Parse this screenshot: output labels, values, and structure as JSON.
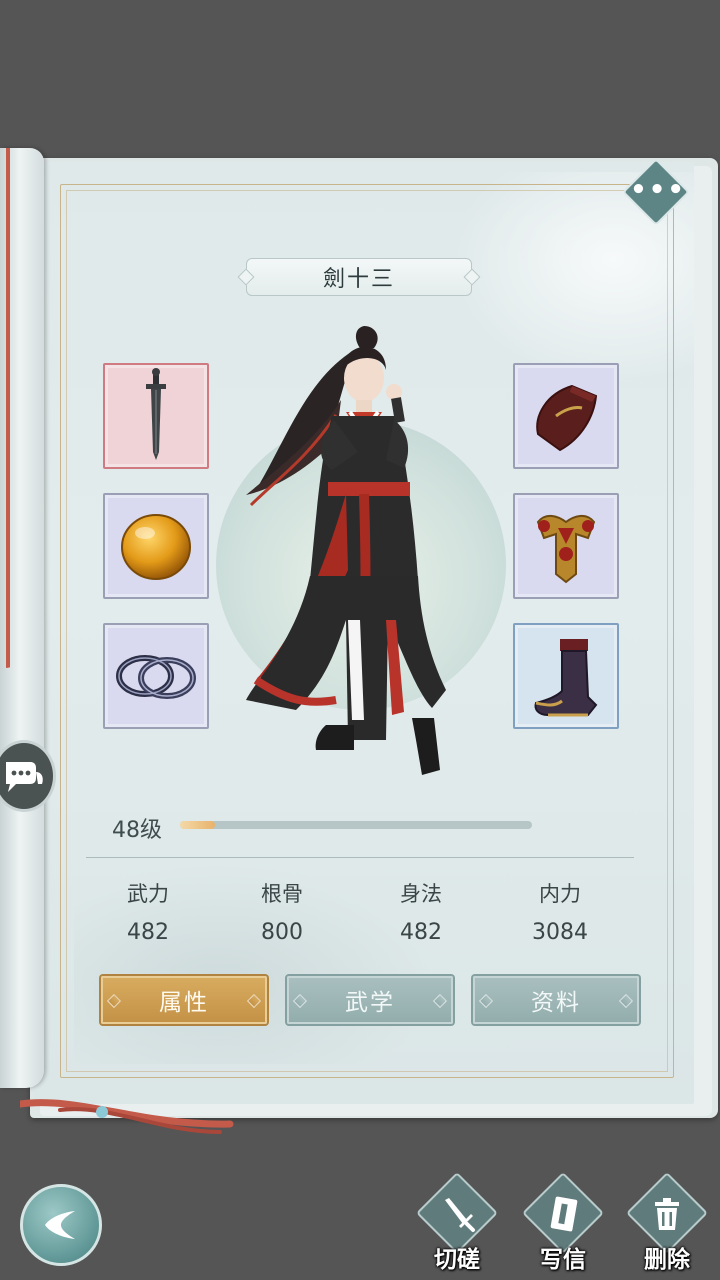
{
  "character": {
    "name": "劍十三",
    "level_label": "48级",
    "level_progress": 0.1
  },
  "equipment": {
    "left": [
      {
        "icon": "sword-icon",
        "rarity_color": "#f0d3d6"
      },
      {
        "icon": "amber-gem-icon",
        "rarity_color": "#d9daf0"
      },
      {
        "icon": "bracelet-icon",
        "rarity_color": "#d9daf0"
      }
    ],
    "right": [
      {
        "icon": "bracer-icon",
        "rarity_color": "#d9daf0"
      },
      {
        "icon": "armor-icon",
        "rarity_color": "#d9daf0"
      },
      {
        "icon": "boot-icon",
        "rarity_color": "#d6e4ef"
      }
    ]
  },
  "stats": [
    {
      "label": "武力",
      "value": "482"
    },
    {
      "label": "根骨",
      "value": "800"
    },
    {
      "label": "身法",
      "value": "482"
    },
    {
      "label": "内力",
      "value": "3084"
    }
  ],
  "tabs": [
    {
      "label": "属性",
      "active": true
    },
    {
      "label": "武学",
      "active": false
    },
    {
      "label": "资料",
      "active": false
    }
  ],
  "actions": [
    {
      "label": "切磋",
      "icon": "sword-icon"
    },
    {
      "label": "写信",
      "icon": "letter-icon"
    },
    {
      "label": "删除",
      "icon": "trash-icon"
    }
  ],
  "menu": {
    "icon": "more-dots-icon",
    "glyph": "•••"
  },
  "colors": {
    "background": "#555555",
    "page": "#e3ecec",
    "tab_active": "#c9994e",
    "tab_inactive": "#9fb7b7",
    "frame_gold": "#c8b48a"
  }
}
